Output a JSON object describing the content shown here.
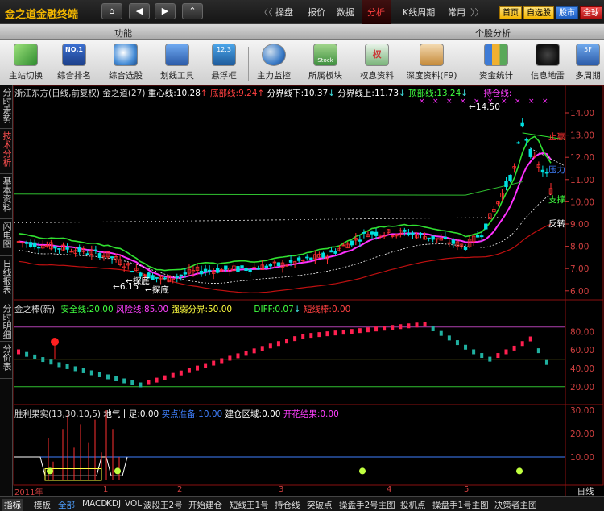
{
  "app": {
    "title": "金之道金融终端"
  },
  "nav_buttons": [
    {
      "name": "home-icon",
      "glyph": "⌂"
    },
    {
      "name": "back-icon",
      "glyph": "◀"
    },
    {
      "name": "forward-icon",
      "glyph": "▶"
    },
    {
      "name": "up-icon",
      "glyph": "⌃"
    }
  ],
  "menu": {
    "collapse_glyph": "〈〈",
    "expand_glyph": "〉〉",
    "items": [
      "操盘",
      "报价",
      "数据",
      "分析",
      "K线周期",
      "常用"
    ],
    "active_index": 3,
    "right_buttons": [
      "首页",
      "自选股",
      "股市",
      "全球"
    ]
  },
  "section": {
    "left": "功能",
    "right": "个股分析"
  },
  "toolbar": {
    "tools": [
      "主站切换",
      "综合排名",
      "综合选股",
      "划线工具",
      "悬浮框",
      "主力监控",
      "所属板块",
      "权息资料",
      "深度资料(F9)",
      "资金统计",
      "信息地雷",
      "多周期"
    ],
    "icon_badges": {
      "t2": "NO.1",
      "t5": "12.3",
      "t7": "Stock",
      "t8": "权",
      "t12": "5F"
    }
  },
  "side_tabs": [
    "分时走势",
    "技术分析",
    "基本资料",
    "闪电图",
    "日线报表",
    "分时明细",
    "分价表"
  ],
  "side_active": 1,
  "main_info": {
    "stock": "浙江东方(日线,前复权)",
    "indicator": "金之道(27)",
    "items": [
      {
        "label": "重心线:",
        "value": "10.28",
        "arrow": "↑",
        "color": "#ffffff"
      },
      {
        "label": "底部线:",
        "value": "9.24",
        "arrow": "↑",
        "color": "#ff4040"
      },
      {
        "label": "分界线下:",
        "value": "10.37",
        "arrow": "↓",
        "color": "#ffffff"
      },
      {
        "label": "分界线上:",
        "value": "11.73",
        "arrow": "↓",
        "color": "#ffffff"
      },
      {
        "label": "顶部线:",
        "value": "13.24",
        "arrow": "↓",
        "color": "#40ff40"
      },
      {
        "label": "持仓线:",
        "value": "",
        "arrow": "",
        "color": "#ff40ff"
      }
    ]
  },
  "main_chart": {
    "y_ticks": [
      "14.00",
      "13.00",
      "12.00",
      "11.00",
      "10.00",
      "9.00",
      "8.00",
      "7.00",
      "6.00"
    ],
    "annotations": {
      "high": "14.50",
      "low": "6.15",
      "bottom1": "探底",
      "bottom2": "探底"
    },
    "right_labels": [
      {
        "text": "止赢",
        "color": "#ff3030"
      },
      {
        "text": "压力",
        "color": "#4080ff"
      },
      {
        "text": "支撑",
        "color": "#40ff40"
      },
      {
        "text": "反转",
        "color": "#ffffff"
      }
    ],
    "colors": {
      "up": "#ff3030",
      "down": "#00e0e0",
      "magenta": "#ff30ff",
      "green": "#30e030",
      "red": "#c01010"
    }
  },
  "sub1_info": {
    "name": "金之棒(新)",
    "items": [
      {
        "label": "安全线:",
        "value": "20.00",
        "color": "#40ff40"
      },
      {
        "label": "风险线:",
        "value": "85.00",
        "color": "#ff40ff"
      },
      {
        "label": "强弱分界:",
        "value": "50.00",
        "color": "#ffff40"
      },
      {
        "label": "DIFF:",
        "value": "0.07",
        "arrow": "↓",
        "color": "#40ff40"
      },
      {
        "label": "短线棒:",
        "value": "0.00",
        "color": "#ff4040"
      }
    ],
    "y_ticks": [
      "80.00",
      "60.00",
      "40.00",
      "20.00"
    ]
  },
  "sub2_info": {
    "name": "胜利果实(13,30,10,5)",
    "items": [
      {
        "label": "地气十足:",
        "value": "0.00",
        "color": "#ffffff"
      },
      {
        "label": "买点准备:",
        "value": "10.00",
        "color": "#4080ff"
      },
      {
        "label": "建仓区域:",
        "value": "0.00",
        "color": "#ffffff"
      },
      {
        "label": "开花结果:",
        "value": "0.00",
        "color": "#ff40ff"
      }
    ],
    "y_ticks": [
      "30.00",
      "20.00",
      "10.00"
    ]
  },
  "date_axis": [
    "2011年",
    "1",
    "2",
    "3",
    "4",
    "5"
  ],
  "period_label": "日线",
  "bottom_tabs": [
    "指标",
    "模板",
    "全部",
    "MACD",
    "KDJ",
    "VOL",
    "波段王2号",
    "开始建仓",
    "短线王1号",
    "持仓线",
    "突破点",
    "操盘手2号主图",
    "投机点",
    "操盘手1号主图",
    "决策者主图"
  ],
  "bottom_active": 2
}
